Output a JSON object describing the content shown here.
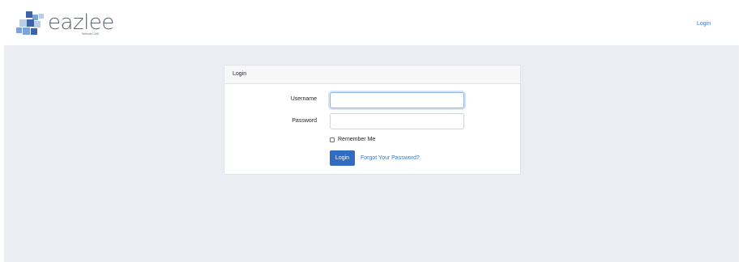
{
  "brand": {
    "name": "eazlee",
    "tagline": "Website CMS",
    "logo_icon": "stacked-cubes-icon",
    "colors": {
      "cube_light": "#b9cde9",
      "cube_mid": "#7ea3d9",
      "cube_dark": "#3b64a8"
    }
  },
  "navbar": {
    "login_link": "Login"
  },
  "login_card": {
    "header": "Login",
    "username_label": "Username",
    "username_value": "",
    "password_label": "Password",
    "password_value": "",
    "remember_label": "Remember Me",
    "remember_checked": false,
    "submit_label": "Login",
    "forgot_link": "Forgot Your Password?"
  },
  "colors": {
    "accent": "#2f6cc2",
    "link": "#3a78c4",
    "background": "#ebedf3"
  }
}
